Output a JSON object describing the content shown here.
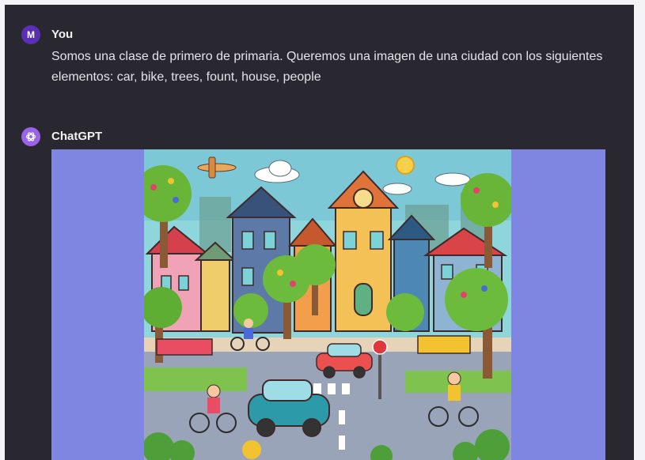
{
  "conversation": {
    "user": {
      "avatar_letter": "M",
      "name": "You",
      "message": "Somos una clase de primero de primaria. Queremos una imagen de una ciudad con los siguientes elementos: car, bike, trees, fount, house, people"
    },
    "assistant": {
      "name": "ChatGPT",
      "avatar_icon": "openai-logo-icon"
    }
  },
  "colors": {
    "background": "#292830",
    "user_avatar": "#5b2fb3",
    "assistant_avatar": "#9a63ea",
    "image_backdrop": "#7e86e2"
  }
}
